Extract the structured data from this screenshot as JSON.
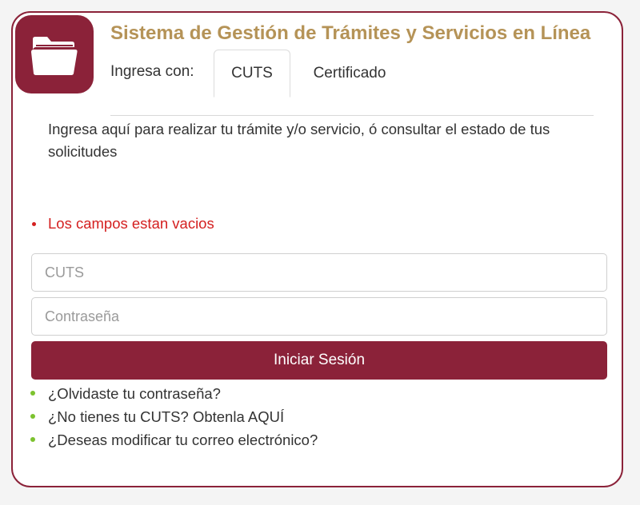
{
  "header": {
    "title": "Sistema de Gestión de Trámites y Servicios en Línea",
    "login_with_label": "Ingresa con:",
    "tabs": [
      {
        "label": "CUTS",
        "active": true
      },
      {
        "label": "Certificado",
        "active": false
      }
    ]
  },
  "intro_text": "Ingresa aquí para realizar tu trámite y/o servicio, ó consultar el estado de tus solicitudes",
  "errors": [
    "Los campos estan vacios"
  ],
  "form": {
    "cuts_placeholder": "CUTS",
    "cuts_value": "",
    "password_placeholder": "Contraseña",
    "password_value": "",
    "submit_label": "Iniciar Sesión"
  },
  "links": [
    "¿Olvidaste tu contraseña?",
    "¿No tienes tu CUTS? Obtenla AQUÍ",
    "¿Deseas modificar tu correo electrónico?"
  ],
  "icons": {
    "logo": "folder-icon"
  },
  "colors": {
    "brand": "#8b2239",
    "title": "#b59357",
    "error": "#d42020",
    "bullet": "#7cc22e"
  }
}
